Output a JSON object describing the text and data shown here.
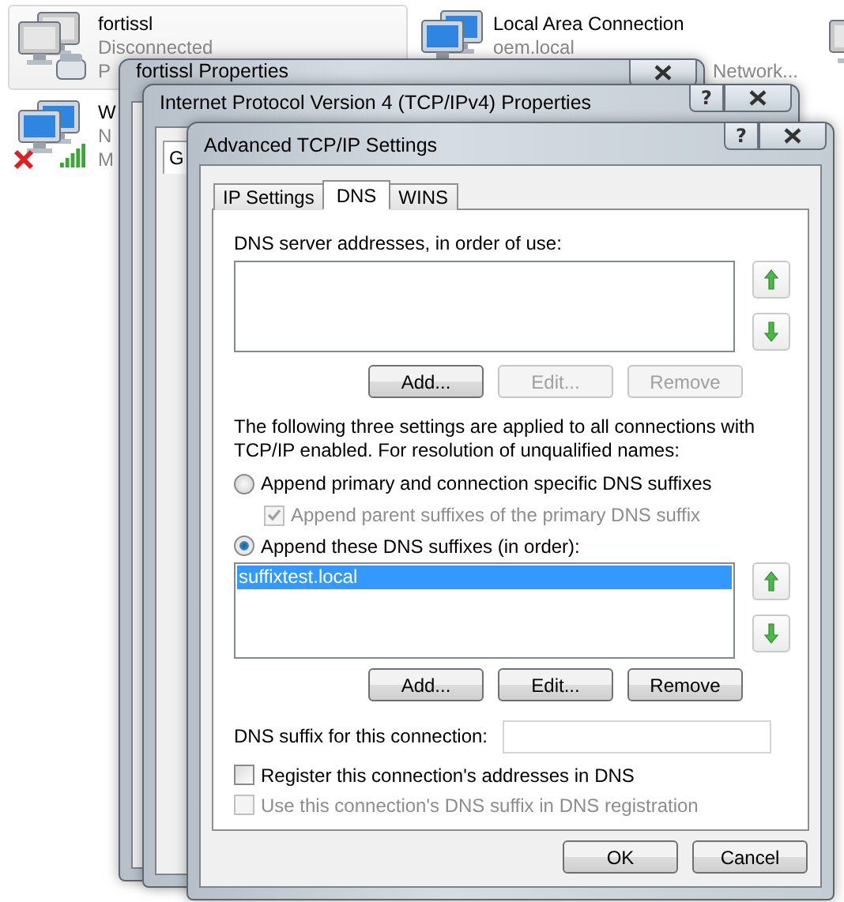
{
  "connections": [
    {
      "name": "fortissl",
      "kind": "dialup",
      "greyed": true,
      "error": false,
      "selected": true,
      "lines": [
        {
          "text": "Disconnected",
          "kind": "head"
        },
        {
          "text": "P",
          "kind": "head"
        }
      ]
    },
    {
      "name": "Local Area Connection",
      "kind": "lan",
      "greyed": false,
      "error": false,
      "selected": false,
      "lines": [
        {
          "text": "oem.local",
          "kind": "head"
        },
        {
          "text": "Network...",
          "kind": "tail"
        }
      ]
    },
    {
      "kind": "lan",
      "greyed": true,
      "error": false,
      "selected": false
    },
    {
      "name": "W",
      "kind": "wireless",
      "greyed": false,
      "error": true,
      "selected": false,
      "lines": [
        {
          "text": "N",
          "kind": "head"
        },
        {
          "text": "M",
          "kind": "head"
        }
      ]
    }
  ],
  "back_windows": [
    {
      "title": "fortissl Properties"
    },
    {
      "title": "Internet Protocol Version 4 (TCP/IPv4) Properties",
      "help": "?",
      "fragment": "G"
    }
  ],
  "dialog": {
    "title": "Advanced TCP/IP Settings",
    "help": "?",
    "tabs": [
      {
        "label": "IP Settings",
        "selected": false
      },
      {
        "label": "DNS",
        "selected": true
      },
      {
        "label": "WINS",
        "selected": false
      }
    ],
    "dns_servers": {
      "label": "DNS server addresses, in order of use:",
      "buttons": [
        {
          "label": "Add...",
          "disabled": false
        },
        {
          "label": "Edit...",
          "disabled": true
        },
        {
          "label": "Remove",
          "disabled": true
        }
      ]
    },
    "note": "The following three settings are applied to all connections with TCP/IP enabled. For resolution of unqualified names:",
    "options": [
      {
        "kind": "radio",
        "label": "Append primary and connection specific DNS suffixes",
        "selected": false,
        "children": [
          {
            "kind": "checkbox",
            "label": "Append parent suffixes of the primary DNS suffix",
            "checked": true,
            "disabled": true
          }
        ]
      },
      {
        "kind": "radio",
        "label": "Append these DNS suffixes (in order):",
        "selected": true
      }
    ],
    "suffixes": {
      "items": [
        {
          "text": "suffixtest.local",
          "selected": true
        }
      ],
      "buttons": [
        {
          "label": "Add...",
          "disabled": false
        },
        {
          "label": "Edit...",
          "disabled": false
        },
        {
          "label": "Remove",
          "disabled": false
        }
      ]
    },
    "suffix_field": {
      "label": "DNS suffix for this connection:"
    },
    "checks": [
      {
        "label": "Register this connection's addresses in DNS",
        "checked": false,
        "disabled": false
      },
      {
        "label": "Use this connection's DNS suffix in DNS registration",
        "checked": false,
        "disabled": true
      }
    ],
    "footer": [
      {
        "label": "OK"
      },
      {
        "label": "Cancel"
      }
    ]
  }
}
